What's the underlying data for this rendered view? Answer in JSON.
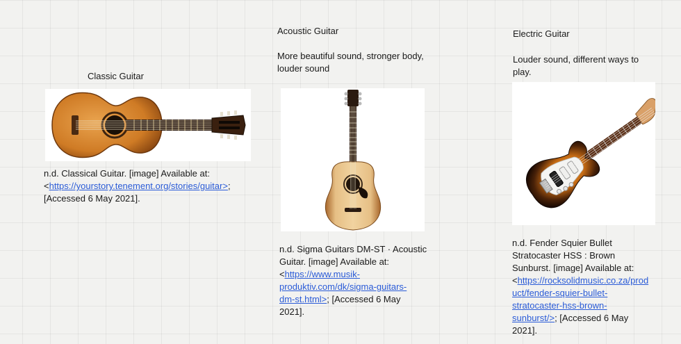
{
  "classic": {
    "title": "Classic Guitar",
    "citation_line1": "n.d. Classical Guitar. [image] Available at:",
    "citation_lt": "<",
    "citation_link": "https://yourstory.tenement.org/stories/guitar>",
    "citation_after": ";",
    "citation_line3": "[Accessed 6 May 2021].",
    "icon": "classical-guitar-image"
  },
  "acoustic": {
    "title": "Acoustic Guitar",
    "desc_line1": "More beautiful sound, stronger body,",
    "desc_line2": "louder sound",
    "citation_line1": "n.d. Sigma Guitars DM-ST · Acoustic",
    "citation_line2": "Guitar. [image] Available at:",
    "citation_lt": "<",
    "citation_link1": "https://www.musik-",
    "citation_link2": "produktiv.com/dk/sigma-guitars-",
    "citation_link3": "dm-st.html>",
    "citation_after": "; [Accessed 6 May",
    "citation_line6": "2021].",
    "icon": "acoustic-guitar-image"
  },
  "electric": {
    "title": "Electric Guitar",
    "desc_line1": "Louder sound, different ways to",
    "desc_line2": "play.",
    "citation_line1": "n.d. Fender Squier Bullet",
    "citation_line2": "Stratocaster HSS : Brown",
    "citation_line3": "Sunburst. [image] Available at:",
    "citation_lt": "<",
    "citation_link1": "https://rocksolidmusic.co.za/prod",
    "citation_link2": "uct/fender-squier-bullet-",
    "citation_link3": "stratocaster-hss-brown-",
    "citation_link4": "sunburst/>",
    "citation_after": "; [Accessed 6 May",
    "citation_line8": "2021].",
    "icon": "electric-guitar-image"
  },
  "colors": {
    "canvas": "#f2f2f0",
    "link": "#2a5bd7",
    "text": "#1a1a1a"
  }
}
